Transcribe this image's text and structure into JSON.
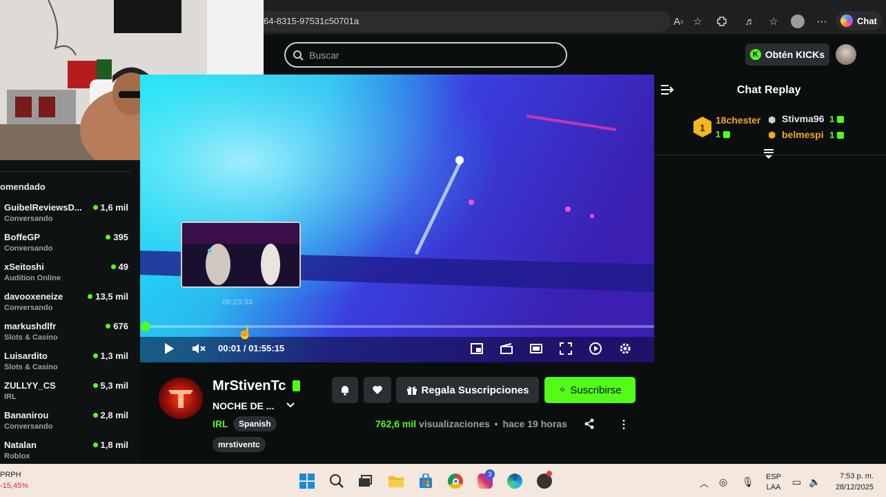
{
  "browser": {
    "url_fragment": "64-8315-97531c50701a",
    "chat_label": "Chat"
  },
  "header": {
    "search_placeholder": "Buscar",
    "kicks_label": "Obtén KICKs",
    "kick_coin_glyph": "K"
  },
  "sidebar": {
    "section_title": "omendado",
    "channels": [
      {
        "name": "GuibelReviewsD...",
        "category": "Conversando",
        "viewers": "1,6 mil"
      },
      {
        "name": "BoffeGP",
        "category": "Conversando",
        "viewers": "395"
      },
      {
        "name": "xSeitoshi",
        "category": "Audition Online",
        "viewers": "49"
      },
      {
        "name": "davooxeneize",
        "category": "Conversando",
        "viewers": "13,5 mil"
      },
      {
        "name": "markushdlfr",
        "category": "Slots & Casino",
        "viewers": "676"
      },
      {
        "name": "Luisardito",
        "category": "Slots & Casino",
        "viewers": "1,3 mil"
      },
      {
        "name": "ZULLYY_CS",
        "category": "IRL",
        "viewers": "5,3 mil"
      },
      {
        "name": "Bananirou",
        "category": "Conversando",
        "viewers": "2,8 mil"
      },
      {
        "name": "Natalan",
        "category": "Roblox",
        "viewers": "1,8 mil"
      }
    ]
  },
  "player": {
    "preview_time": "00:23:33",
    "current_time": "00:01",
    "separator": "/",
    "duration": "01:55:15",
    "progress_fraction": 0.0
  },
  "chat": {
    "title": "Chat Replay",
    "leaderboard": [
      {
        "rank": "1",
        "name": "18chester",
        "count": "1",
        "color": "#f5a623"
      },
      {
        "name": "Stivma96",
        "count": "1",
        "color": "#e8e8e8"
      },
      {
        "name": "belmespi",
        "count": "1",
        "color": "#f5a623"
      }
    ]
  },
  "stream": {
    "streamer": "MrStivenTc",
    "title": "NOCHE DE ...",
    "category": "IRL",
    "language_tag": "Spanish",
    "tag": "mrstiventc",
    "gift_label": "Regala Suscripciones",
    "subscribe_label": "Suscribirse",
    "views_count": "762,6 mil",
    "views_label": "visualizaciones",
    "dot_separator": "•",
    "ago": "hace 19 horas"
  },
  "taskbar": {
    "ticker_name": "PRPH",
    "ticker_change": "-15,45%",
    "lang_line1": "ESP",
    "lang_line2": "LAA",
    "time": "7:53 p. m.",
    "date": "28/12/2025",
    "instagram_badge": "3"
  },
  "colors": {
    "kick_green": "#53fc18",
    "background": "#0b0e0f",
    "taskbar": "#f3e7de"
  }
}
